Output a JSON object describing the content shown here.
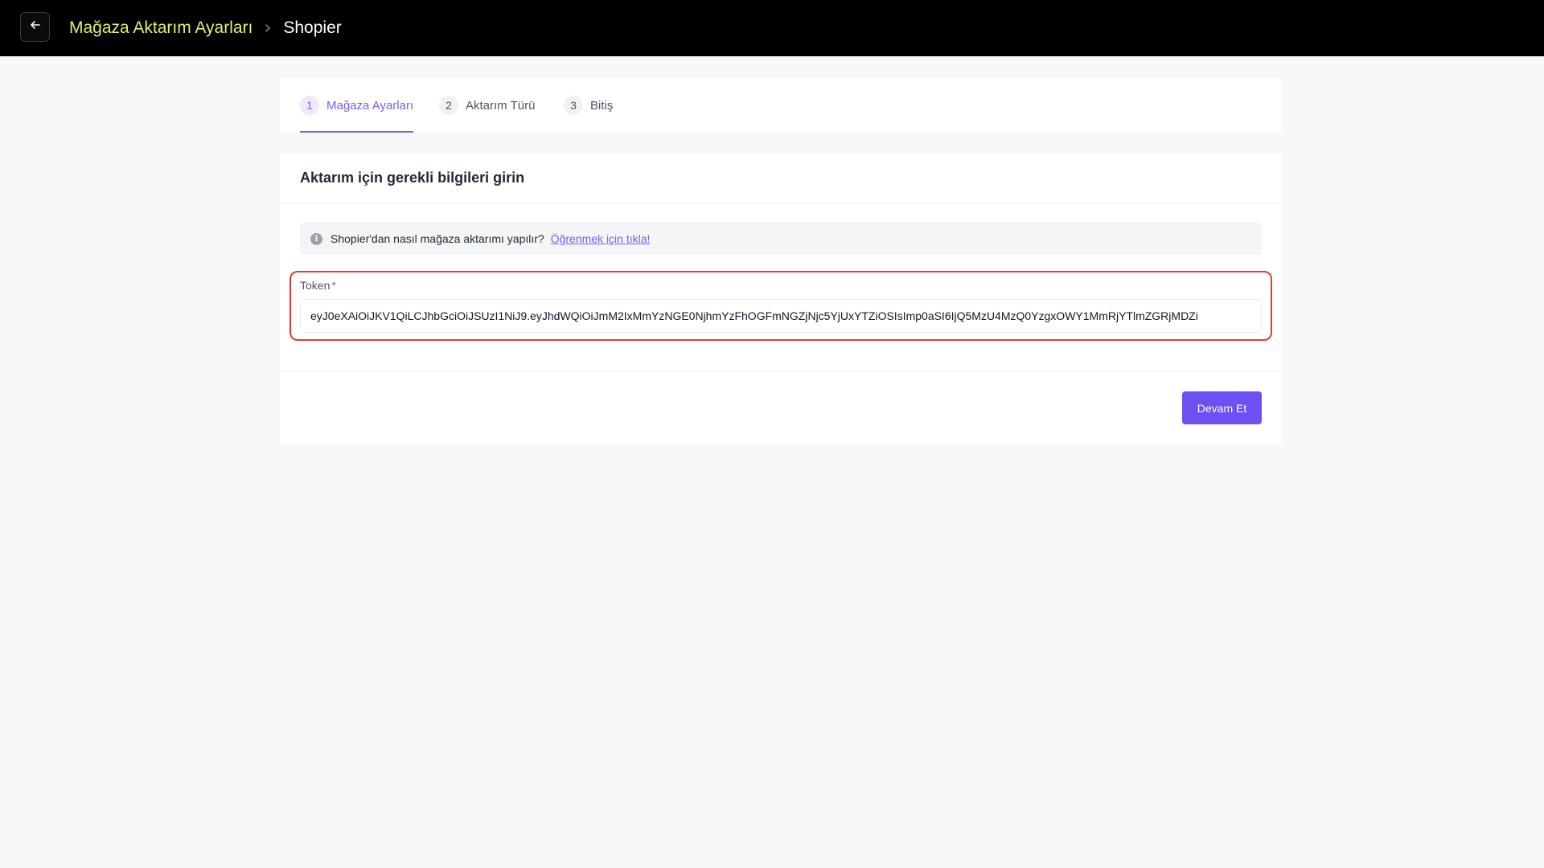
{
  "header": {
    "back_icon": "arrow-left-icon",
    "breadcrumb_parent": "Mağaza Aktarım Ayarları",
    "breadcrumb_separator_icon": "chevron-right-icon",
    "breadcrumb_current": "Shopier"
  },
  "steps": [
    {
      "number": "1",
      "label": "Mağaza Ayarları",
      "active": true
    },
    {
      "number": "2",
      "label": "Aktarım Türü",
      "active": false
    },
    {
      "number": "3",
      "label": "Bitiş",
      "active": false
    }
  ],
  "form": {
    "title": "Aktarım için gerekli bilgileri girin",
    "info_icon": "info-icon",
    "info_text": "Shopier'dan nasıl mağaza aktarımı yapılır?",
    "info_link": "Öğrenmek için tıkla!",
    "token_label": "Token",
    "required_mark": "*",
    "token_value": "eyJ0eXAiOiJKV1QiLCJhbGciOiJSUzI1NiJ9.eyJhdWQiOiJmM2IxMmYzNGE0NjhmYzFhOGFmNGZjNjc5YjUxYTZiOSIsImp0aSI6IjQ5MzU4MzQ0YzgxOWY1MmRjYTlmZGRjMDZi",
    "continue_button": "Devam Et"
  },
  "colors": {
    "accent": "#6d4ff2",
    "breadcrumb_link": "#e4f06a",
    "highlight_border": "#e53935"
  }
}
